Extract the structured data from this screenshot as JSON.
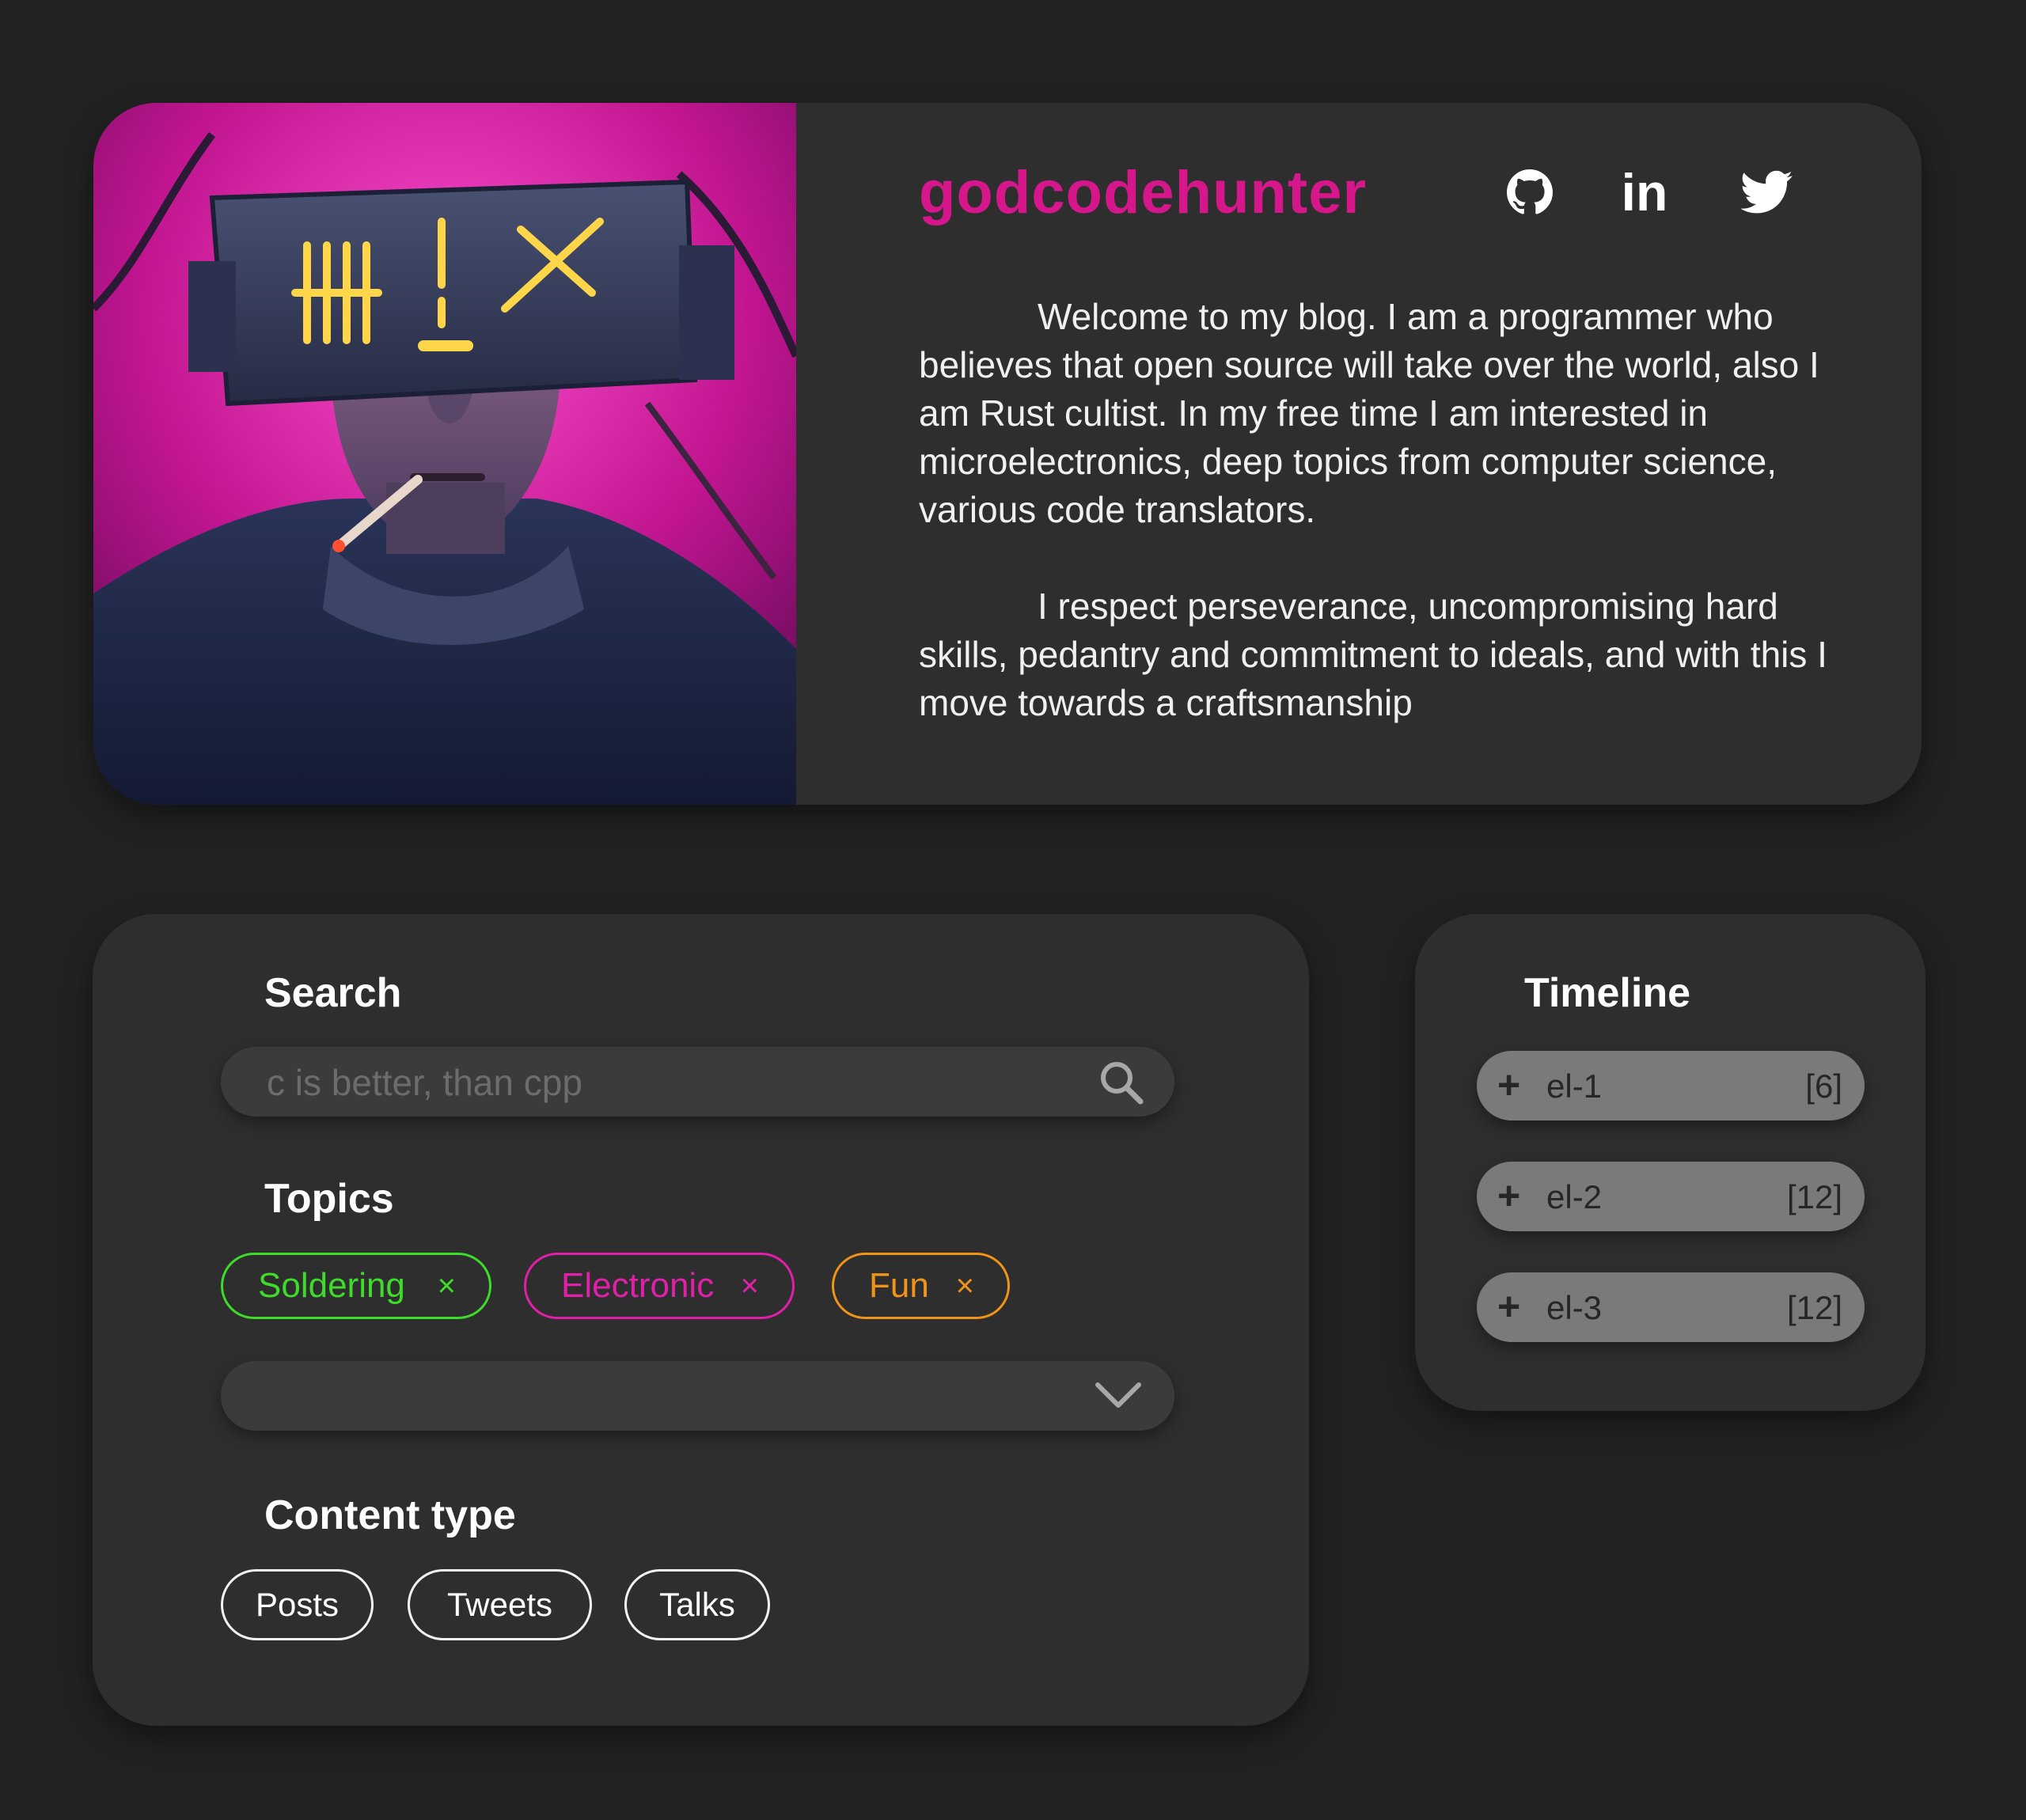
{
  "colors": {
    "background": "#222222",
    "card": "#2e2e2e",
    "accent_username": "#d6178c",
    "tag_soldering": "#3ddc2a",
    "tag_electronic": "#e020a8",
    "tag_fun": "#f09418"
  },
  "profile": {
    "avatar_alt": "cyberpunk portrait with glowing visor",
    "username": "godcodehunter",
    "social": [
      {
        "icon": "github-icon"
      },
      {
        "icon": "linkedin-icon",
        "label": "in"
      },
      {
        "icon": "twitter-icon"
      }
    ],
    "bio": [
      "Welcome to my blog. I am a programmer who believes that open source will take over the world, also I am Rust cultist. In my free time I am interested in microelectronics, deep topics from computer science, various code translators.",
      "I respect perseverance, uncompromising hard skills, pedantry and commitment to ideals, and with this I move towards a craftsmanship"
    ]
  },
  "filters": {
    "search_title": "Search",
    "search_placeholder": "c is better, than cpp",
    "topics_title": "Topics",
    "topics": [
      {
        "label": "Soldering",
        "remove": "×"
      },
      {
        "label": "Electronic",
        "remove": "×"
      },
      {
        "label": "Fun",
        "remove": "×"
      }
    ],
    "content_type_title": "Content type",
    "content_types": [
      "Posts",
      "Tweets",
      "Talks"
    ]
  },
  "timeline": {
    "title": "Timeline",
    "items": [
      {
        "label": "el-1",
        "count": "[6]"
      },
      {
        "label": "el-2",
        "count": "[12]"
      },
      {
        "label": "el-3",
        "count": "[12]"
      }
    ]
  }
}
